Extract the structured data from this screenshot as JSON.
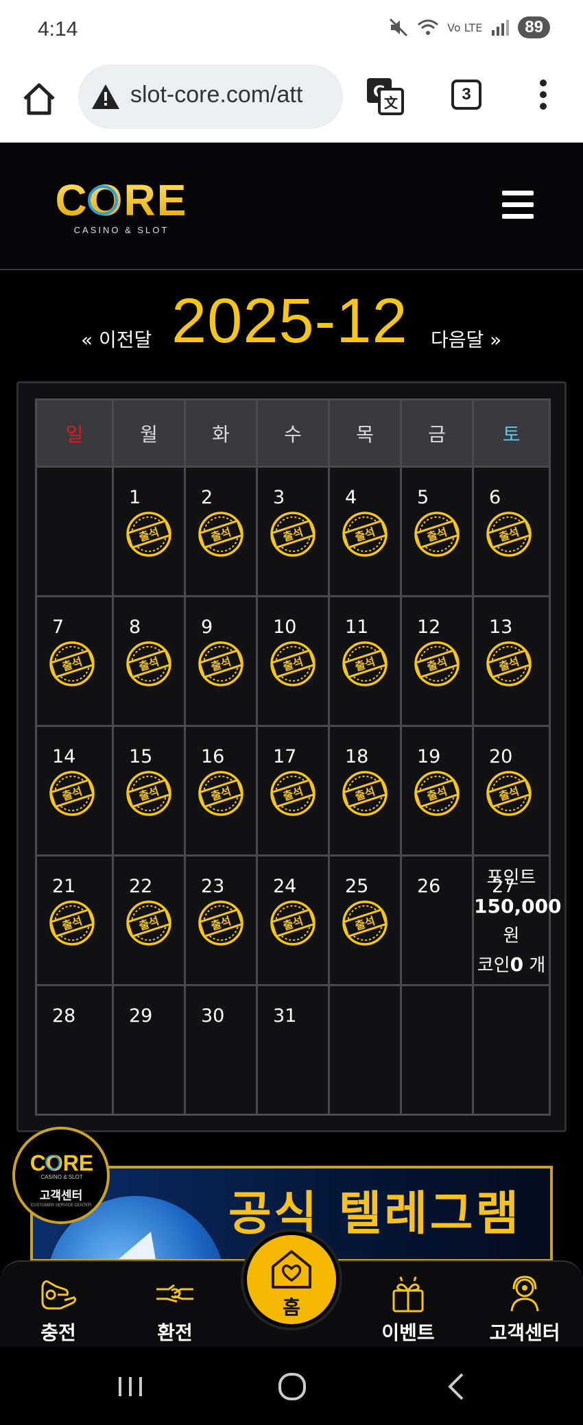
{
  "status_bar": {
    "time": "4:14",
    "battery": "89",
    "signal_text": "Vo LTE"
  },
  "browser": {
    "url": "slot-core.com/att",
    "tab_count": "3"
  },
  "site": {
    "logo_text": "CORE",
    "logo_sub": "CASINO & SLOT"
  },
  "calendar_nav": {
    "prev_label": "« 이전달",
    "next_label": "다음달 »",
    "month_title": "2025-12"
  },
  "calendar": {
    "weekdays": [
      "일",
      "월",
      "화",
      "수",
      "목",
      "금",
      "토"
    ],
    "weeks": [
      [
        "",
        "1",
        "2",
        "3",
        "4",
        "5",
        "6"
      ],
      [
        "7",
        "8",
        "9",
        "10",
        "11",
        "12",
        "13"
      ],
      [
        "14",
        "15",
        "16",
        "17",
        "18",
        "19",
        "20"
      ],
      [
        "21",
        "22",
        "23",
        "24",
        "25",
        "26",
        "27"
      ],
      [
        "28",
        "29",
        "30",
        "31",
        "",
        "",
        ""
      ]
    ],
    "stamp_text": "출석",
    "point_summary": {
      "point_label": "포인트",
      "point_value": "150,000",
      "point_unit": "원",
      "coin_label": "코인",
      "coin_value": "0",
      "coin_unit": "개"
    }
  },
  "banner": {
    "title": "공식 텔레그램"
  },
  "cs_badge": {
    "label": "고객센터",
    "sub": "CUSTOMER SERVICE CENTER"
  },
  "bottom_nav": {
    "deposit": "충전",
    "withdraw": "환전",
    "home": "홈",
    "event": "이벤트",
    "support": "고객센터"
  },
  "colors": {
    "accent_gold": "#f5c518",
    "sunday_red": "#e3161d",
    "saturday_blue": "#5ec3ef"
  }
}
